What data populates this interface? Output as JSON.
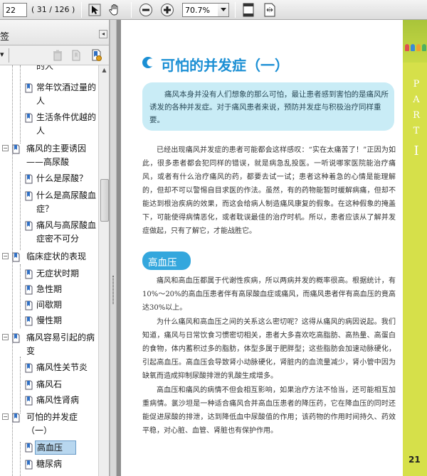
{
  "toolbar": {
    "page_current": "22",
    "page_count": "( 31 / 126 )",
    "zoom": "70.7%"
  },
  "panel": {
    "title": "签",
    "close_glyph": "◂",
    "dropdown_glyph": "▾"
  },
  "tree": [
    {
      "label": "的人"
    },
    {
      "label": "常年饮酒过量的人"
    },
    {
      "label": "生活条件优越的人"
    },
    {
      "label": "痛风的主要诱因——高尿酸"
    },
    {
      "label": "什么是尿酸？"
    },
    {
      "label": "什么是高尿酸血症？"
    },
    {
      "label": "痛风与高尿酸血症密不可分"
    },
    {
      "label": "临床症状的表现"
    },
    {
      "label": "无症状时期"
    },
    {
      "label": "急性期"
    },
    {
      "label": "间歇期"
    },
    {
      "label": "慢性期"
    },
    {
      "label": "痛风容易引起的病变"
    },
    {
      "label": "痛风性关节炎"
    },
    {
      "label": "痛风石"
    },
    {
      "label": "痛风性肾病"
    },
    {
      "label": "可怕的并发症（一）"
    },
    {
      "label": "高血压"
    },
    {
      "label": "糖尿病"
    }
  ],
  "page": {
    "chapter_title": "可怕的并发症（一）",
    "intro": "痛风本身并没有人们想象的那么可怕，最让患者感到害怕的是痛风所诱发的各种并发症。对于痛风患者来说，预防并发症与积极治疗同样重要。",
    "para1": "已经出现痛风并发症的患者可能都会这样感叹：“实在太痛苦了！”正因为如此，很多患者都会犯同样的错误，就是病急乱投医。一听说哪家医院能治疗痛风，或者有什么治疗痛风的药，都要去试一试；患者这种着急的心情是能理解的，但却不可以警惕自目求医的作法。虽然，有的药物能暂时缓解病痛，但却不能达到根治疾病的效果，而这会给病人制造痛风康复的假象。在这种假象的掩盖下，可能使得病情恶化，或者耽误最佳的治疗时机。所以，患者应该从了解并发症做起，只有了解它，才能战胜它。",
    "section_title": "高血压",
    "para2": "痛风和高血压都属于代谢性疾病，所以两病并发的概率很高。根据统计，有10%～20%的高血压患者伴有高尿酸血症或痛风，而痛风患者伴有高血压的竟高达30%以上。",
    "para3": "为什么痛风和高血压之间的关系这么密切呢？这得从痛风的病因说起。我们知道，痛风与日常饮食习惯密切相关，患者大多喜欢吃高脂肪、高热量、高蛋白的食物，体内蓄积过多的脂肪，体型多属于肥胖型；这些脂肪会加速动脉硬化，引起高血压。高血压会导致肾小动脉硬化，肾脏内的血流量减少，肾小管中因为缺氧而造成抑制尿酸排泄的乳酸生成增多。",
    "para4": "高血压和痛风的病情不但会相互影响，如果治疗方法不恰当，还可能相互加重病情。氯沙坦是一种适合痛风合并高血压患者的降压药，它在降血压的同时还能促进尿酸的排泄，达到降低血中尿酸值的作用；该药物的作用时间持久、药效平稳，对心脏、血管、肾脏也有保护作用。",
    "part_label": "PART",
    "part_number": "Ⅰ",
    "page_number": "21"
  },
  "colors": {
    "title_blue": "#1b8fd4",
    "intro_bg": "#c9ecf6",
    "badge_blue": "#34a7dd",
    "band_green": "#d6e04a",
    "selected_bg": "#b8d7ef"
  }
}
